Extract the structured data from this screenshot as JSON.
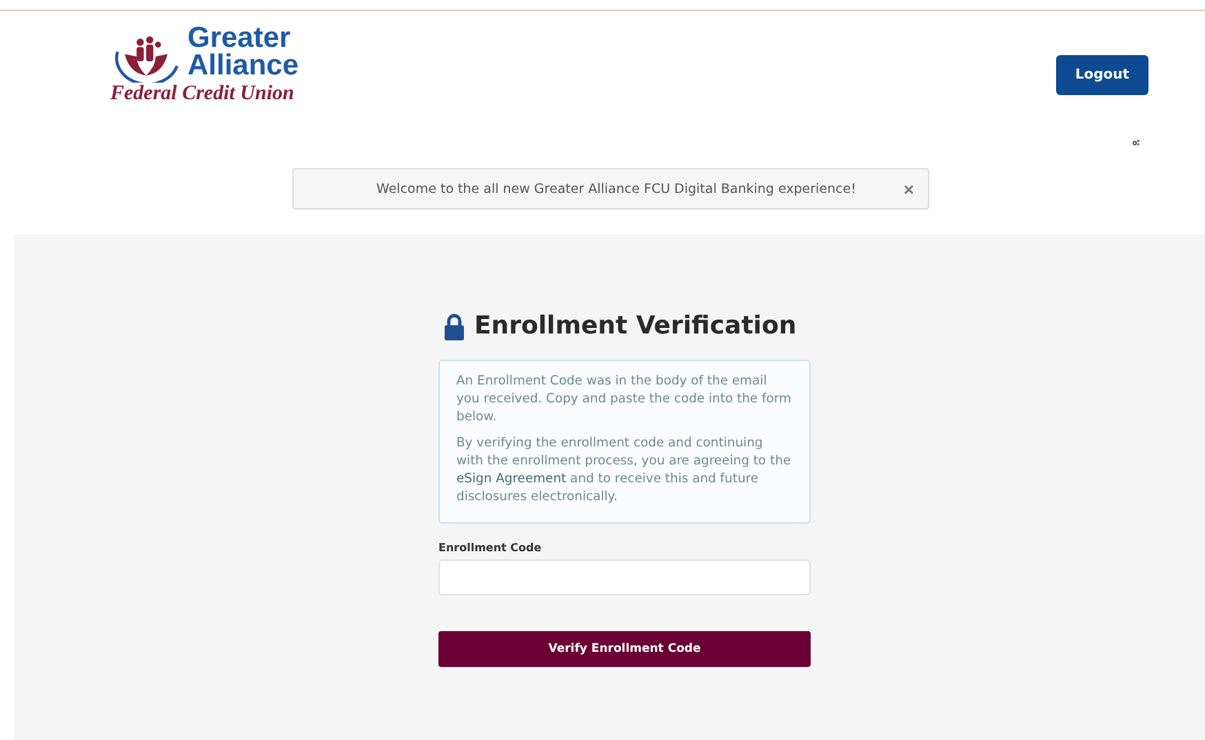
{
  "logo": {
    "line_1": "Greater",
    "line_2": "Alliance",
    "tagline": "Federal Credit Union"
  },
  "logout_button": "Logout",
  "banner": {
    "message": "Welcome to the all new Greater Alliance FCU Digital Banking experience!",
    "close": "×"
  },
  "title": "Enrollment Verification",
  "info": {
    "paragraph_1": "An Enrollment Code was in the body of the email you received. Copy and paste the code into the form below.",
    "paragraph_2": {
      "before": "By verifying the enrollment code and continuing with the enrollment process, you are agreeing to the ",
      "link": "eSign Agreement",
      "after": " and to receive this and future disclosures electronically."
    }
  },
  "field": {
    "label": "Enrollment Code"
  },
  "submit_button": "Verify Enrollment Code"
}
